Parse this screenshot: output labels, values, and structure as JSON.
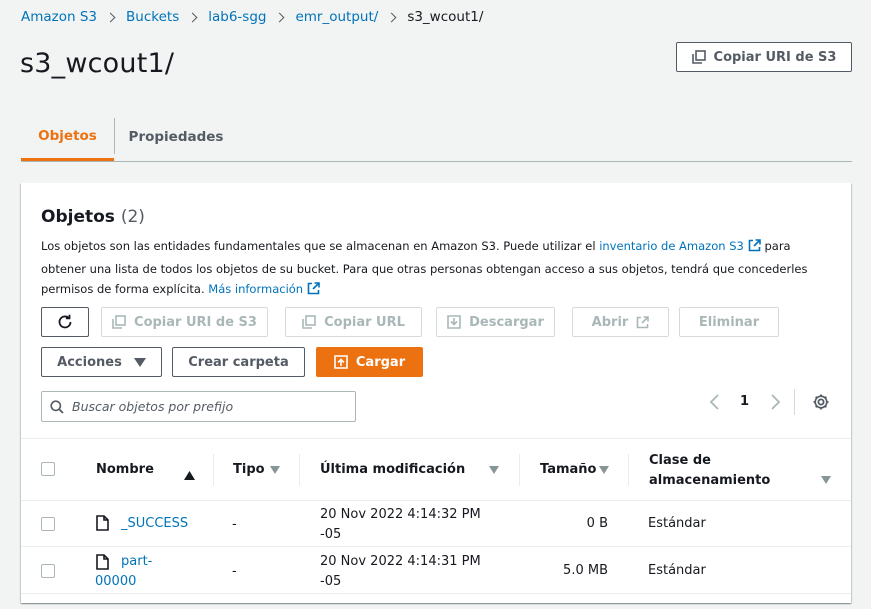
{
  "breadcrumb": {
    "items": [
      "Amazon S3",
      "Buckets",
      "lab6-sgg",
      "emr_output/"
    ],
    "current": "s3_wcout1/"
  },
  "page": {
    "title": "s3_wcout1/",
    "copy_uri_label": "Copiar URI de S3"
  },
  "tabs": [
    {
      "label": "Objetos",
      "active": true
    },
    {
      "label": "Propiedades",
      "active": false
    }
  ],
  "objects_panel": {
    "title": "Objetos",
    "count": "(2)",
    "description_1": "Los objetos son las entidades fundamentales que se almacenan en Amazon S3. Puede utilizar el",
    "inventory_link": "inventario de Amazon S3",
    "description_2": "para obtener una lista de todos los objetos de su bucket. Para que otras personas obtengan acceso a sus objetos, tendrá que concederles permisos de forma explícita.",
    "more_info_link": "Más información",
    "toolbar": {
      "copy_uri": "Copiar URI de S3",
      "copy_url": "Copiar URL",
      "download": "Descargar",
      "open": "Abrir",
      "delete": "Eliminar",
      "actions": "Acciones",
      "create_folder": "Crear carpeta",
      "upload": "Cargar"
    },
    "search_placeholder": "Buscar objetos por prefijo",
    "page_number": "1",
    "columns": {
      "name": "Nombre",
      "type": "Tipo",
      "modified": "Última modificación",
      "size": "Tamaño",
      "storage_1": "Clase de",
      "storage_2": "almacenamiento"
    },
    "rows": [
      {
        "name_1": "_SUCCESS",
        "name_2": "",
        "type": "-",
        "modified_1": "20 Nov 2022 4:14:32 PM",
        "modified_2": "-05",
        "size": "0 B",
        "storage": "Estándar"
      },
      {
        "name_1": "part-",
        "name_2": "00000",
        "type": "-",
        "modified_1": "20 Nov 2022 4:14:31 PM",
        "modified_2": "-05",
        "size": "5.0 MB",
        "storage": "Estándar"
      }
    ]
  },
  "colors": {
    "accent": "#ec7211",
    "link": "#0073bb",
    "text": "#16191f",
    "muted": "#545b64",
    "disabled": "#aab7b8"
  }
}
